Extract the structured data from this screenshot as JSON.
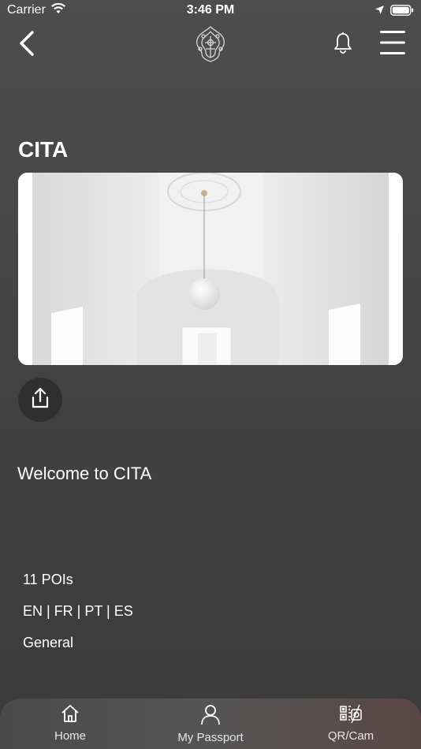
{
  "status": {
    "carrier": "Carrier",
    "time": "3:46 PM"
  },
  "nav": {
    "back_icon": "chevron-left-icon",
    "logo": "ornament-logo",
    "bell_icon": "bell-icon",
    "menu_icon": "hamburger-menu-icon"
  },
  "page": {
    "title": "CITA",
    "welcome": "Welcome to CITA",
    "pois": "11 POIs",
    "languages": "EN | FR | PT | ES",
    "category": "General"
  },
  "tabs": [
    {
      "label": "Home",
      "icon": "home-icon"
    },
    {
      "label": "My Passport",
      "icon": "user-icon"
    },
    {
      "label": "QR/Cam",
      "icon": "qr-camera-icon"
    }
  ],
  "colors": {
    "background": "#474747",
    "tabbar": "#555555",
    "share_button": "#2f2f2f"
  }
}
